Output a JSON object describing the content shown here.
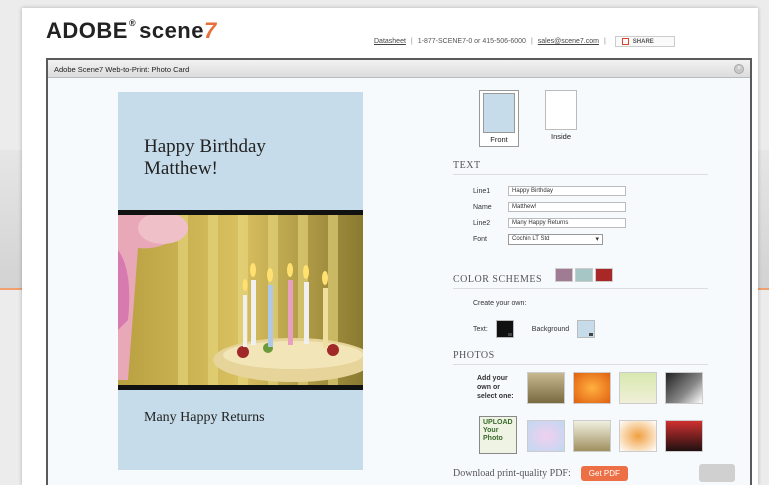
{
  "site": {
    "logo_adobe": "ADOBE",
    "logo_tm": "®",
    "logo_scene": "scene",
    "logo_seven": "7",
    "datasheet_link": "Datasheet",
    "phone": "1-877-SCENE7-0 or 415-506-6000",
    "email_link": "sales@scene7.com",
    "share_label": "SHARE"
  },
  "window": {
    "title": "Adobe Scene7 Web-to-Print: Photo Card",
    "close_label": "×"
  },
  "card": {
    "title_line1": "Happy Birthday",
    "title_line2": "Matthew!",
    "footer": "Many Happy Returns",
    "background_color": "#c6dcea"
  },
  "views": [
    {
      "label": "Front",
      "selected": true
    },
    {
      "label": "Inside",
      "selected": false
    }
  ],
  "text_section": {
    "heading": "TEXT",
    "fields": [
      {
        "label": "Line1",
        "value": "Happy Birthday"
      },
      {
        "label": "Name",
        "value": "Matthew!"
      },
      {
        "label": "Line2",
        "value": "Many Happy Returns"
      }
    ],
    "font_label": "Font",
    "font_value": "Cochin LT Std"
  },
  "color_schemes": {
    "heading": "COLOR SCHEMES",
    "swatches": [
      "#a07c94",
      "#a6c6c6",
      "#a82828"
    ],
    "create_label": "Create your own:",
    "text_label": "Text:",
    "text_color": "#111111",
    "background_label": "Background",
    "background_color": "#c6dcea"
  },
  "photos": {
    "heading": "PHOTOS",
    "prompt_line1": "Add your",
    "prompt_line2": "own or",
    "prompt_line3": "select one:",
    "upload_line1": "UPLOAD",
    "upload_line2": "Your",
    "upload_line3": "Photo"
  },
  "pdf": {
    "label": "Download print-quality PDF:",
    "button": "Get PDF"
  }
}
